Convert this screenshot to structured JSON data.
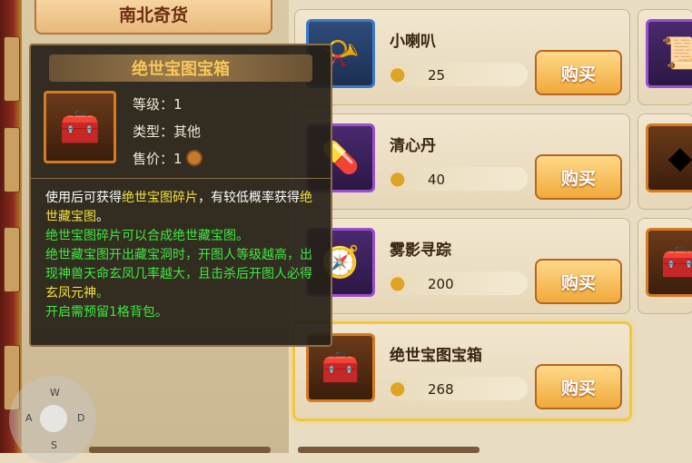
{
  "category": {
    "label": "南北奇货"
  },
  "shop_items": [
    {
      "name": "小喇叭",
      "price": "25",
      "buy_label": "购买",
      "icon": "horn-icon",
      "frame": "blue"
    },
    {
      "name": "清心丹",
      "price": "40",
      "buy_label": "购买",
      "icon": "pill-icon",
      "frame": "purple"
    },
    {
      "name": "雾影寻踪",
      "price": "200",
      "buy_label": "购买",
      "icon": "compass-icon",
      "frame": "purple"
    },
    {
      "name": "绝世宝图宝箱",
      "price": "268",
      "buy_label": "购买",
      "icon": "treasure-chest-icon",
      "frame": "orange",
      "selected": true
    }
  ],
  "tooltip": {
    "title": "绝世宝图宝箱",
    "level_label": "等级：",
    "level_value": "1",
    "type_label": "类型：",
    "type_value": "其他",
    "price_label": "售价：",
    "price_value": "1",
    "desc": {
      "p1": "使用后可获得",
      "p1_hl": "绝世宝图碎片",
      "p2": "，有较低概率获得",
      "p2_hl": "绝世藏宝图",
      "p3": "。",
      "green1": "绝世宝图碎片可以合成绝世藏宝图。",
      "green2": "绝世藏宝图开出藏宝洞时，开图人等级越高，出现神兽天命玄凤几率越大，且击杀后开图人必得",
      "green2_hl": "玄凤元神",
      "green3": "。",
      "green4": "开启需预留1格背包。"
    }
  },
  "joystick": {
    "up": "W",
    "left": "A",
    "right": "D",
    "down": "S"
  },
  "colors": {
    "gold": "#f7c75a",
    "highlight_yellow": "#f6e23a",
    "highlight_green": "#3fea3f",
    "selected_border": "#f2c542"
  }
}
